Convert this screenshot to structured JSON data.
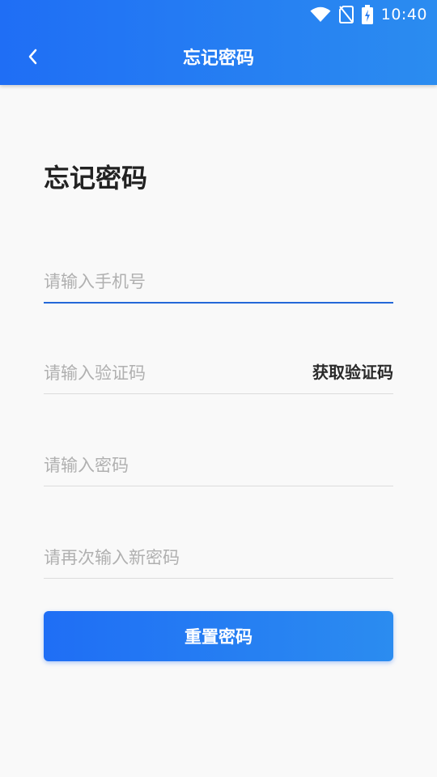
{
  "status_bar": {
    "time": "10:40",
    "icons": [
      "wifi-icon",
      "no-sim-icon",
      "battery-charging-icon"
    ]
  },
  "toolbar": {
    "back_icon": "chevron-left-icon",
    "title": "忘记密码"
  },
  "page": {
    "heading": "忘记密码"
  },
  "form": {
    "phone_placeholder": "请输入手机号",
    "code_placeholder": "请输入验证码",
    "get_code_label": "获取验证码",
    "password_placeholder": "请输入密码",
    "confirm_placeholder": "请再次输入新密码",
    "submit_label": "重置密码"
  },
  "colors": {
    "primary": "#1f6ef5",
    "primary_end": "#2b8cf0",
    "background": "#f9f9f9",
    "active_underline": "#2468d8"
  }
}
